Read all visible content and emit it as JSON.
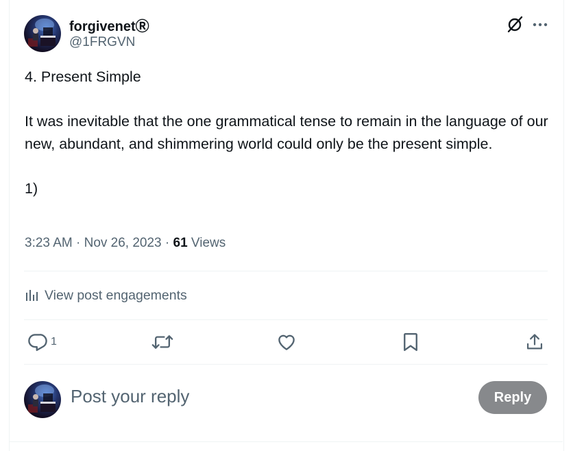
{
  "author": {
    "name": "forgivenetⓇ",
    "handle": "@1FRGVN",
    "avatar_icon": "avatar-pianist-image"
  },
  "post": {
    "title_line": "4. Present Simple",
    "paragraph": "It was inevitable that the one grammatical tense to remain in the language of our new, abundant, and shimmering world could only be the present simple.",
    "footer_line": "1)"
  },
  "meta": {
    "timestamp": "3:23 AM · Nov 26, 2023",
    "separator": " · ",
    "views_count": "61",
    "views_label": " Views"
  },
  "engagements": {
    "label": "View post engagements",
    "icon": "bar-chart-icon"
  },
  "actions": {
    "reply_count": "1",
    "icons": [
      "reply-icon",
      "repost-icon",
      "like-icon",
      "bookmark-icon",
      "share-icon"
    ]
  },
  "reply_box": {
    "placeholder": "Post your reply",
    "button_label": "Reply"
  },
  "header_icons": [
    "grok-icon",
    "more-icon"
  ],
  "colors": {
    "text_primary": "#0f1419",
    "text_secondary": "#536471",
    "divider": "#eff3f4",
    "reply_button_bg": "#87898c"
  }
}
